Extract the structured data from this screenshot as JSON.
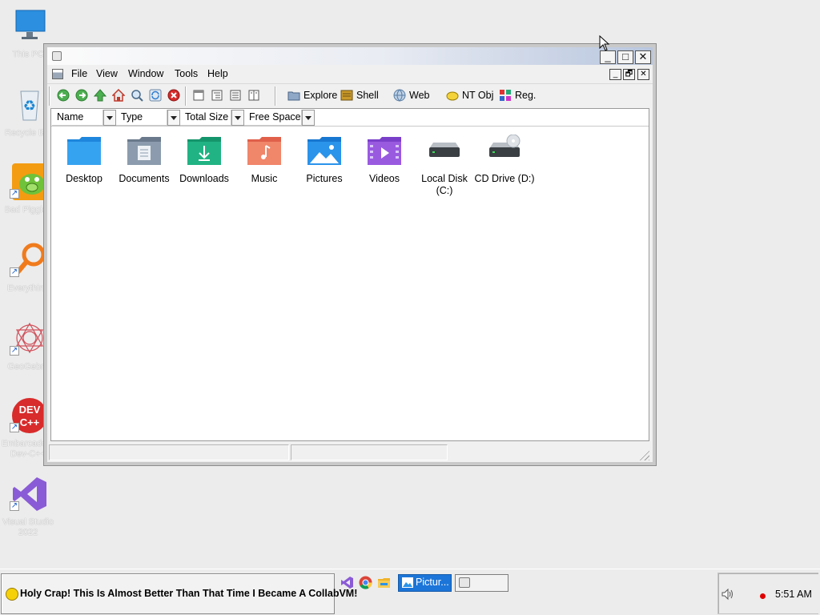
{
  "desktop": {
    "icons": [
      {
        "name": "This PC",
        "label": "This PC"
      },
      {
        "name": "Recycle Bin",
        "label": "Recycle Bin"
      },
      {
        "name": "Bad Piggies",
        "label": "Bad Piggies"
      },
      {
        "name": "Everything",
        "label": "Everything"
      },
      {
        "name": "GeoGebra",
        "label": "GeoGebra"
      },
      {
        "name": "Embarcadero Dev-C++",
        "label": "Embarcadero Dev-C++"
      },
      {
        "name": "Visual Studio 2022",
        "label": "Visual Studio 2022"
      }
    ]
  },
  "window": {
    "title": "",
    "controls": {
      "minimize": "_",
      "maximize": "□",
      "close": "✕"
    },
    "mdi_controls": {
      "minimize": "_",
      "restore": "🗗",
      "close": "✕"
    },
    "menu": [
      "File",
      "View",
      "Window",
      "Tools",
      "Help"
    ],
    "toolbar": {
      "nav_icons": [
        "back-arrow-icon",
        "forward-arrow-icon",
        "up-arrow-icon",
        "home-icon",
        "search-icon",
        "refresh-icon",
        "stop-icon"
      ],
      "view_icons": [
        "view-large-icon",
        "view-small-icon",
        "view-list-icon",
        "view-details-icon"
      ],
      "labels": {
        "explore": "Explore",
        "shell": "Shell",
        "web": "Web",
        "ntobj": "NT Obj",
        "reg": "Reg."
      }
    },
    "columns": [
      "Name",
      "Type",
      "Total Size",
      "Free Space"
    ],
    "items": [
      {
        "label": "Desktop",
        "icon": "desktop-folder-icon"
      },
      {
        "label": "Documents",
        "icon": "documents-folder-icon"
      },
      {
        "label": "Downloads",
        "icon": "downloads-folder-icon"
      },
      {
        "label": "Music",
        "icon": "music-folder-icon"
      },
      {
        "label": "Pictures",
        "icon": "pictures-folder-icon"
      },
      {
        "label": "Videos",
        "icon": "videos-folder-icon"
      },
      {
        "label": "Local Disk\n(C:)",
        "icon": "local-disk-icon"
      },
      {
        "label": "CD Drive (D:)",
        "icon": "cd-drive-icon"
      }
    ],
    "status": [
      "",
      ""
    ]
  },
  "taskbar": {
    "start_text": "Holy Crap! This Is Almost Better Than That Time I Became A CollabVM!",
    "quick_launch": [
      "visual-studio-icon",
      "chrome-icon",
      "file-explorer-icon"
    ],
    "tasks": [
      {
        "label": "Pictur...",
        "active": true
      },
      {
        "label": "",
        "active": false
      }
    ],
    "clock": "5:51 AM"
  },
  "colors": {
    "accent": "#1c75d8",
    "desktop_bg": "#ececec",
    "title_gradient_end": "#b8c6de"
  }
}
